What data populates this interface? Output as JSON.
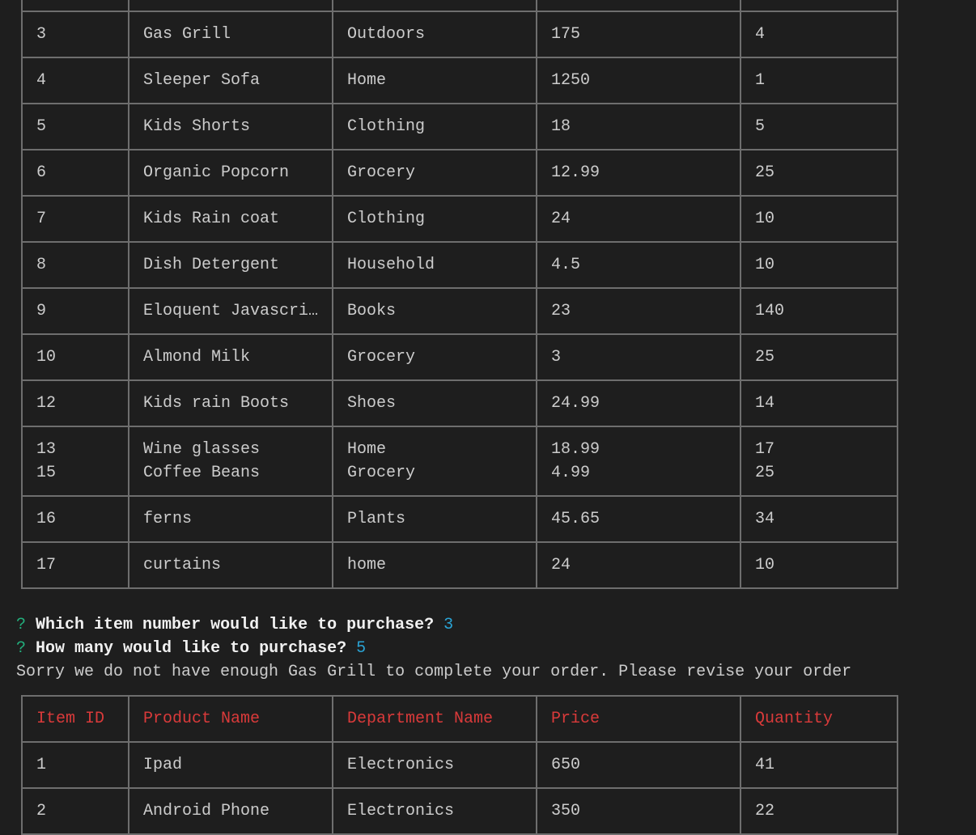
{
  "top_table": {
    "rows": [
      [
        [
          ""
        ],
        [
          ""
        ],
        [
          ""
        ],
        [
          ""
        ],
        [
          ""
        ]
      ],
      [
        [
          "3"
        ],
        [
          "Gas Grill"
        ],
        [
          "Outdoors"
        ],
        [
          "175"
        ],
        [
          "4"
        ]
      ],
      [
        [
          "4"
        ],
        [
          "Sleeper Sofa"
        ],
        [
          "Home"
        ],
        [
          "1250"
        ],
        [
          "1"
        ]
      ],
      [
        [
          "5"
        ],
        [
          "Kids Shorts"
        ],
        [
          "Clothing"
        ],
        [
          "18"
        ],
        [
          "5"
        ]
      ],
      [
        [
          "6"
        ],
        [
          "Organic Popcorn"
        ],
        [
          "Grocery"
        ],
        [
          "12.99"
        ],
        [
          "25"
        ]
      ],
      [
        [
          "7"
        ],
        [
          "Kids Rain coat"
        ],
        [
          "Clothing"
        ],
        [
          "24"
        ],
        [
          "10"
        ]
      ],
      [
        [
          "8"
        ],
        [
          "Dish Detergent"
        ],
        [
          "Household"
        ],
        [
          "4.5"
        ],
        [
          "10"
        ]
      ],
      [
        [
          "9"
        ],
        [
          "Eloquent Javascri…"
        ],
        [
          "Books"
        ],
        [
          "23"
        ],
        [
          "140"
        ]
      ],
      [
        [
          "10"
        ],
        [
          "Almond Milk"
        ],
        [
          "Grocery"
        ],
        [
          "3"
        ],
        [
          "25"
        ]
      ],
      [
        [
          "12"
        ],
        [
          "Kids rain Boots"
        ],
        [
          "Shoes"
        ],
        [
          "24.99"
        ],
        [
          "14"
        ]
      ],
      [
        [
          "13",
          "15"
        ],
        [
          "Wine glasses",
          "Coffee Beans"
        ],
        [
          "Home",
          "Grocery"
        ],
        [
          "18.99",
          "4.99"
        ],
        [
          "17",
          "25"
        ]
      ],
      [
        [
          "16"
        ],
        [
          "ferns"
        ],
        [
          "Plants"
        ],
        [
          "45.65"
        ],
        [
          "34"
        ]
      ],
      [
        [
          "17"
        ],
        [
          "curtains"
        ],
        [
          "home"
        ],
        [
          "24"
        ],
        [
          "10"
        ]
      ]
    ]
  },
  "prompts": [
    {
      "marker": "?",
      "question": "Which item number would like to purchase?",
      "answer": "3"
    },
    {
      "marker": "?",
      "question": "How many would like to purchase?",
      "answer": "5"
    }
  ],
  "message": "Sorry we do not have enough Gas Grill to complete your order. Please revise your order",
  "bottom_table": {
    "headers": [
      "Item ID",
      "Product Name",
      "Department Name",
      "Price",
      "Quantity"
    ],
    "rows": [
      [
        [
          "1"
        ],
        [
          "Ipad"
        ],
        [
          "Electronics"
        ],
        [
          "650"
        ],
        [
          "41"
        ]
      ],
      [
        [
          "2"
        ],
        [
          "Android Phone"
        ],
        [
          "Electronics"
        ],
        [
          "350"
        ],
        [
          "22"
        ]
      ]
    ]
  },
  "colors": {
    "background": "#1e1e1e",
    "header_text": "#d93a3a",
    "prompt_marker": "#23b07d",
    "answer": "#2aa3d4"
  }
}
